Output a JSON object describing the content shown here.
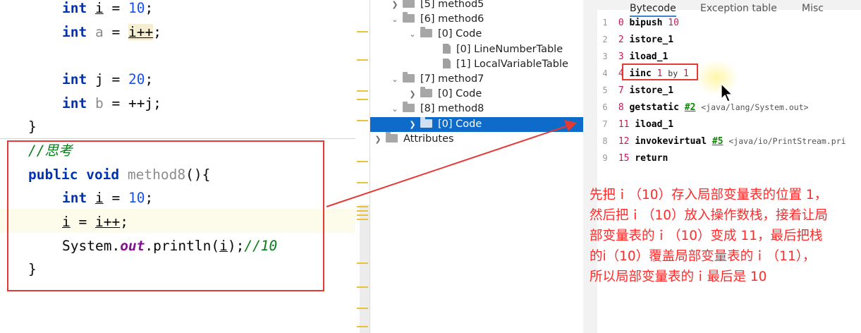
{
  "code": {
    "l1": {
      "kw": "int",
      "var": "i",
      "rest": " = ",
      "num": "10",
      "end": ";"
    },
    "l2": {
      "kw": "int",
      "var": "a",
      "eq": " = ",
      "expr": "i++",
      "end": ";"
    },
    "l3": {
      "kw": "int",
      "var": "j",
      "rest": " = ",
      "num": "20",
      "end": ";"
    },
    "l4": {
      "kw": "int",
      "var": "b",
      "rest": " = ++j;"
    },
    "l5": "}",
    "comment": "//思考",
    "method_kw1": "public",
    "method_kw2": "void",
    "method_name": "method8",
    "method_sig": "(){",
    "m1": {
      "kw": "int",
      "var": "i",
      "rest": " = ",
      "num": "10",
      "end": ";"
    },
    "m2": {
      "lhs": "i",
      "eq": " = ",
      "rhs": "i++",
      "end": ";"
    },
    "m3": {
      "cls": "System.",
      "field": "out",
      "call": ".println(",
      "arg": "i",
      "close": ");",
      "cmt": "//10"
    },
    "close": "}"
  },
  "tree": {
    "items": [
      {
        "label": "[5] method5"
      },
      {
        "label": "[6] method6"
      },
      {
        "label": "[0] Code"
      },
      {
        "label": "[0] LineNumberTable"
      },
      {
        "label": "[1] LocalVariableTable"
      },
      {
        "label": "[7] method7"
      },
      {
        "label": "[0] Code"
      },
      {
        "label": "[8] method8"
      },
      {
        "label": "[0] Code"
      },
      {
        "label": "Attributes"
      }
    ]
  },
  "bytecode": {
    "tabs": [
      "Bytecode",
      "Exception table",
      "Misc"
    ],
    "lines": [
      {
        "n": "1",
        "off": "0",
        "op": "bipush",
        "arg": "10"
      },
      {
        "n": "2",
        "off": "2",
        "op": "istore_1"
      },
      {
        "n": "3",
        "off": "3",
        "op": "iload_1"
      },
      {
        "n": "4",
        "off": "4",
        "op": "iinc",
        "arg": "1",
        "by": "by",
        "arg2": "1"
      },
      {
        "n": "5",
        "off": "7",
        "op": "istore_1"
      },
      {
        "n": "6",
        "off": "8",
        "op": "getstatic",
        "ref": "#2",
        "cmt": "<java/lang/System.out>"
      },
      {
        "n": "7",
        "off": "11",
        "op": "iload_1"
      },
      {
        "n": "8",
        "off": "12",
        "op": "invokevirtual",
        "ref": "#5",
        "cmt": "<java/io/PrintStream.pri"
      },
      {
        "n": "9",
        "off": "15",
        "op": "return"
      }
    ]
  },
  "annotation": {
    "lines": [
      "先把ｉ（10）存入局部变量表的位置 1，",
      "然后把ｉ（10）放入操作数栈，接着让局",
      "部变量表的ｉ（10）变成 11，最后把栈",
      "的i（10）覆盖局部变量表的ｉ（11），",
      "所以局部变量表的ｉ最后是 10"
    ]
  },
  "colors": {
    "accent_red": "#e53935",
    "selection_blue": "#0f6bc9",
    "annotation_red": "#ff2a2a"
  }
}
